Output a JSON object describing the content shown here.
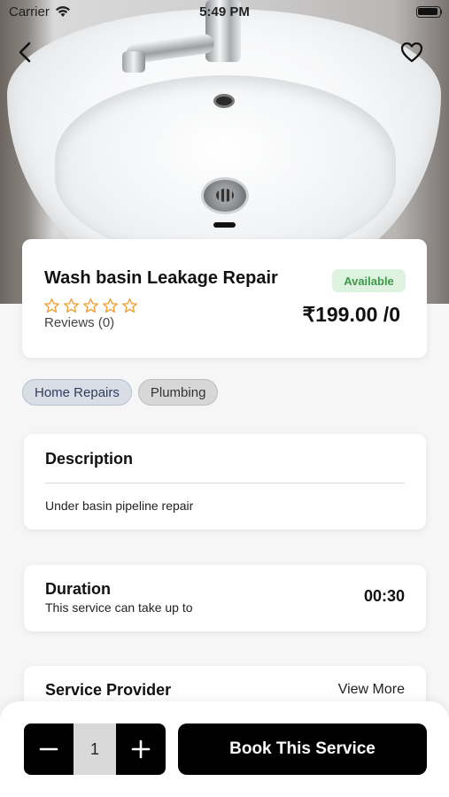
{
  "status_bar": {
    "carrier": "Carrier",
    "time": "5:49 PM"
  },
  "icons": {
    "back": "chevron-left-icon",
    "favorite": "heart-icon",
    "star": "star-outline-icon",
    "minus": "minus-icon",
    "plus": "plus-icon"
  },
  "service": {
    "title": "Wash basin Leakage Repair",
    "availability": "Available",
    "rating": 0,
    "rating_max": 5,
    "reviews_label": "Reviews (0)",
    "price": "₹199.00 /0"
  },
  "categories": [
    "Home Repairs",
    "Plumbing"
  ],
  "description": {
    "heading": "Description",
    "text": "Under basin pipeline repair"
  },
  "duration": {
    "heading": "Duration",
    "subtitle": "This service can take up to",
    "value": "00:30"
  },
  "provider": {
    "heading": "Service Provider",
    "view_more": "View More"
  },
  "booking": {
    "quantity": "1",
    "book_label": "Book This Service"
  },
  "colors": {
    "accent": "#000000",
    "star": "#f0a23a",
    "available_bg": "#ddf3df",
    "available_text": "#3e9a4a"
  }
}
